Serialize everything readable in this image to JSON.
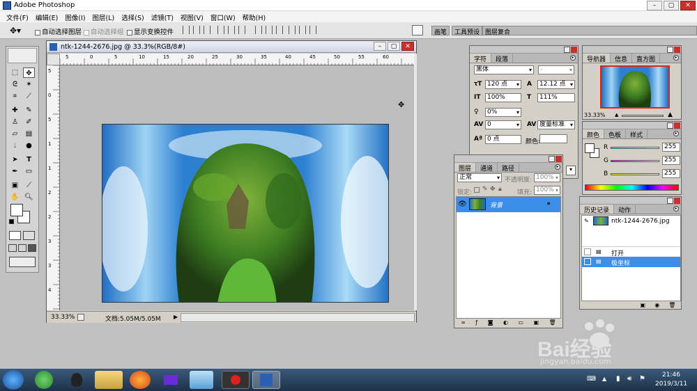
{
  "app": {
    "title": "Adobe Photoshop"
  },
  "menu": [
    "文件(F)",
    "编辑(E)",
    "图像(I)",
    "图层(L)",
    "选择(S)",
    "滤镜(T)",
    "视图(V)",
    "窗口(W)",
    "帮助(H)"
  ],
  "options": {
    "auto_select_layer": "自动选择图层",
    "auto_select_group": "自动选择组",
    "show_transform": "显示变换控件"
  },
  "palette_well": [
    "画笔",
    "工具预设",
    "图层复合"
  ],
  "document": {
    "title": "ntk-1244-2676.jpg @ 33.3%(RGB/8#)",
    "zoom": "33.33%",
    "doc_size": "文档:5.05M/5.05M",
    "ruler_h": [
      "5",
      "0",
      "5",
      "10",
      "15",
      "20",
      "25",
      "30",
      "35",
      "40",
      "45",
      "50",
      "55",
      "60"
    ],
    "ruler_v": [
      "5",
      "0",
      "5",
      "1",
      "1",
      "2",
      "2",
      "3",
      "3",
      "4"
    ]
  },
  "character": {
    "tabs": [
      "字符",
      "段落"
    ],
    "font": "黑体",
    "style": "-",
    "size": "120 点",
    "leading": "12.12 点",
    "vscale": "100%",
    "hscale": "111%",
    "tracking_pct": "0%",
    "kerning": "0",
    "kerning_mode": "度量标准",
    "baseline": "0 点",
    "color_label": "颜色:"
  },
  "navigator": {
    "tabs": [
      "导航器",
      "信息",
      "直方图"
    ],
    "zoom": "33.33%"
  },
  "color": {
    "tabs": [
      "颜色",
      "色板",
      "样式"
    ],
    "r_label": "R",
    "g_label": "G",
    "b_label": "B",
    "r": "255",
    "g": "255",
    "b": "255"
  },
  "layers": {
    "tabs": [
      "图层",
      "通道",
      "路径"
    ],
    "blend": "正常",
    "opacity_label": "不透明度:",
    "opacity": "100%",
    "lock_label": "锁定:",
    "fill_label": "填充:",
    "fill": "100%",
    "layer_name": "背景"
  },
  "history": {
    "tabs": [
      "历史记录",
      "动作"
    ],
    "snapshot": "ntk-1244-2676.jpg",
    "items": [
      "打开",
      "极坐标"
    ]
  },
  "taskbar": {
    "time": "21:46",
    "date": "2019/3/11"
  },
  "watermark": {
    "text": "Bai经验",
    "url": "jingyan.baidu.com"
  },
  "colors": {
    "accent": "#3b7bd9",
    "selected": "#3d8ee8"
  }
}
